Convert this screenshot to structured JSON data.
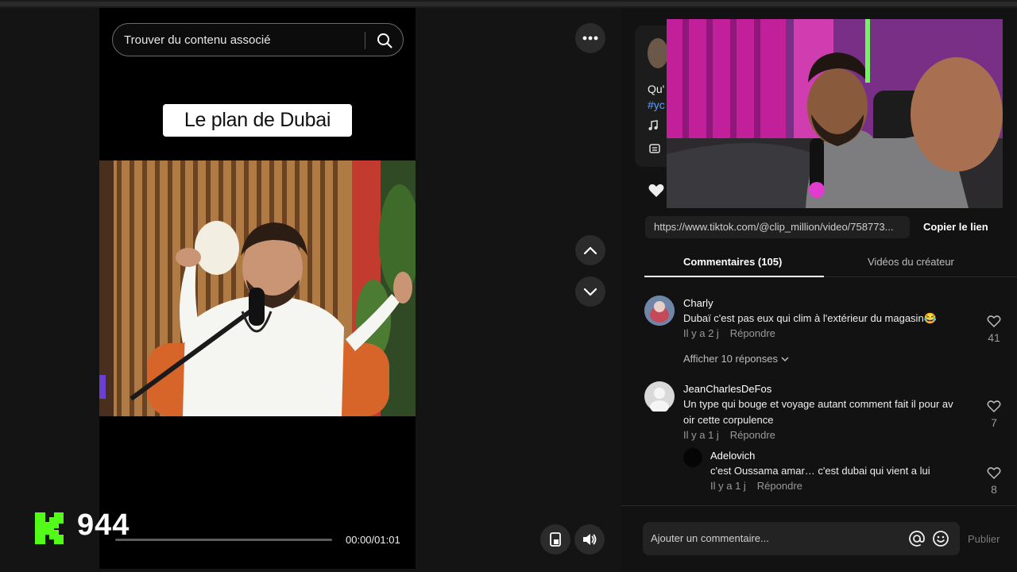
{
  "player": {
    "search_placeholder": "Trouver du contenu associé",
    "caption_title": "Le plan de Dubai",
    "time": "00:00/01:01",
    "progress_fraction": 0.0,
    "overlay_count": "944"
  },
  "description": {
    "fragment_line1": "Qu'",
    "fragment_line2": "#yc"
  },
  "share": {
    "url": "https://www.tiktok.com/@clip_million/video/758773...",
    "copy_label": "Copier le lien"
  },
  "tabs": {
    "comments": "Commentaires (105)",
    "creator_videos": "Vidéos du créateur"
  },
  "comments": [
    {
      "user": "Charly",
      "text": "Dubaï c'est pas eux qui clim à l'extérieur du magasin😂",
      "age": "Il y a 2 j",
      "reply_label": "Répondre",
      "likes": "41",
      "show_replies": "Afficher 10 réponses"
    },
    {
      "user": "JeanCharlesDeFos",
      "text_line1": "Un type qui bouge et voyage autant comment fait il pour av",
      "text_line2": "oir cette corpulence",
      "age": "Il y a 1 j",
      "reply_label": "Répondre",
      "likes": "7"
    },
    {
      "user": "Adelovich",
      "text": "c'est Oussama amar… c'est dubai qui vient a lui",
      "age": "Il y a 1 j",
      "reply_label": "Répondre",
      "likes": "8"
    }
  ],
  "composer": {
    "placeholder": "Ajouter un commentaire...",
    "publish_label": "Publier"
  },
  "colors": {
    "background": "#121212",
    "kick_green": "#53fc18",
    "link_blue": "#5aa0ff"
  }
}
